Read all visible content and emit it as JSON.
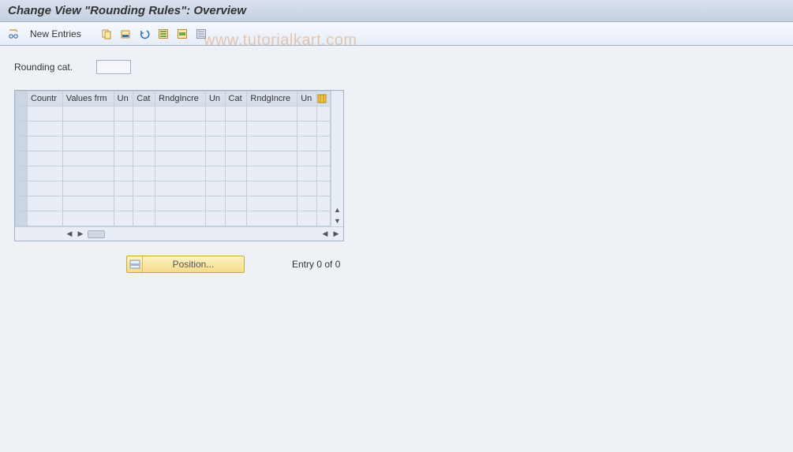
{
  "title": "Change View \"Rounding Rules\": Overview",
  "toolbar": {
    "new_entries_label": "New Entries"
  },
  "field": {
    "rounding_cat_label": "Rounding cat.",
    "rounding_cat_value": ""
  },
  "table": {
    "columns": [
      "Countr",
      "Values frm",
      "Un",
      "Cat",
      "RndgIncre",
      "Un",
      "Cat",
      "RndgIncre",
      "Un"
    ],
    "rows": [
      [
        "",
        "",
        "",
        "",
        "",
        "",
        "",
        "",
        ""
      ],
      [
        "",
        "",
        "",
        "",
        "",
        "",
        "",
        "",
        ""
      ],
      [
        "",
        "",
        "",
        "",
        "",
        "",
        "",
        "",
        ""
      ],
      [
        "",
        "",
        "",
        "",
        "",
        "",
        "",
        "",
        ""
      ],
      [
        "",
        "",
        "",
        "",
        "",
        "",
        "",
        "",
        ""
      ],
      [
        "",
        "",
        "",
        "",
        "",
        "",
        "",
        "",
        ""
      ],
      [
        "",
        "",
        "",
        "",
        "",
        "",
        "",
        "",
        ""
      ],
      [
        "",
        "",
        "",
        "",
        "",
        "",
        "",
        "",
        ""
      ]
    ]
  },
  "position_button_label": "Position...",
  "entry_status": "Entry 0 of 0",
  "watermark": "www.tutorialkart.com"
}
